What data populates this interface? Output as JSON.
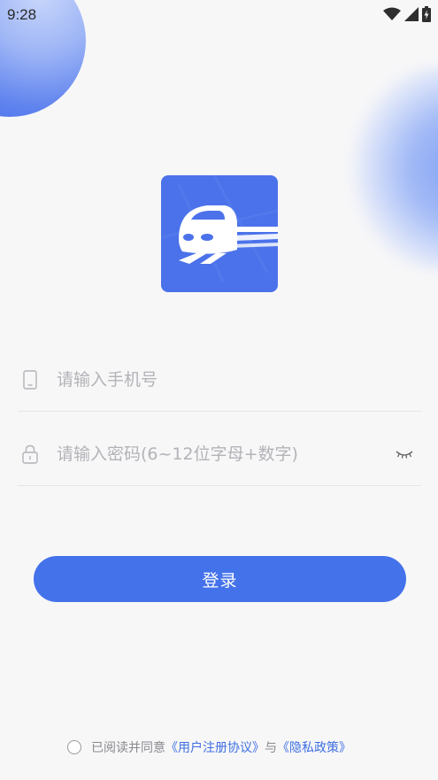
{
  "status_bar": {
    "time": "9:28",
    "icons": [
      "wifi-icon",
      "signal-icon",
      "battery-charging-icon"
    ]
  },
  "logo": {
    "icon": "train-icon",
    "background_color": "#4b72ea"
  },
  "login_form": {
    "phone": {
      "placeholder": "请输入手机号",
      "value": "",
      "icon": "phone-icon"
    },
    "password": {
      "placeholder": "请输入密码(6~12位字母+数字)",
      "value": "",
      "icon": "lock-icon",
      "visibility_icon": "eye-closed-icon"
    },
    "login_label": "登录"
  },
  "agreement": {
    "prefix": "已阅读并同意",
    "user_agreement": "《用户注册协议》",
    "conjunction": "与",
    "privacy_policy": "《隐私政策》",
    "checked": false
  },
  "colors": {
    "accent": "#4472ea",
    "link": "#3f6fe0",
    "placeholder": "#b3b3b8",
    "background": "#f7f7f8"
  }
}
